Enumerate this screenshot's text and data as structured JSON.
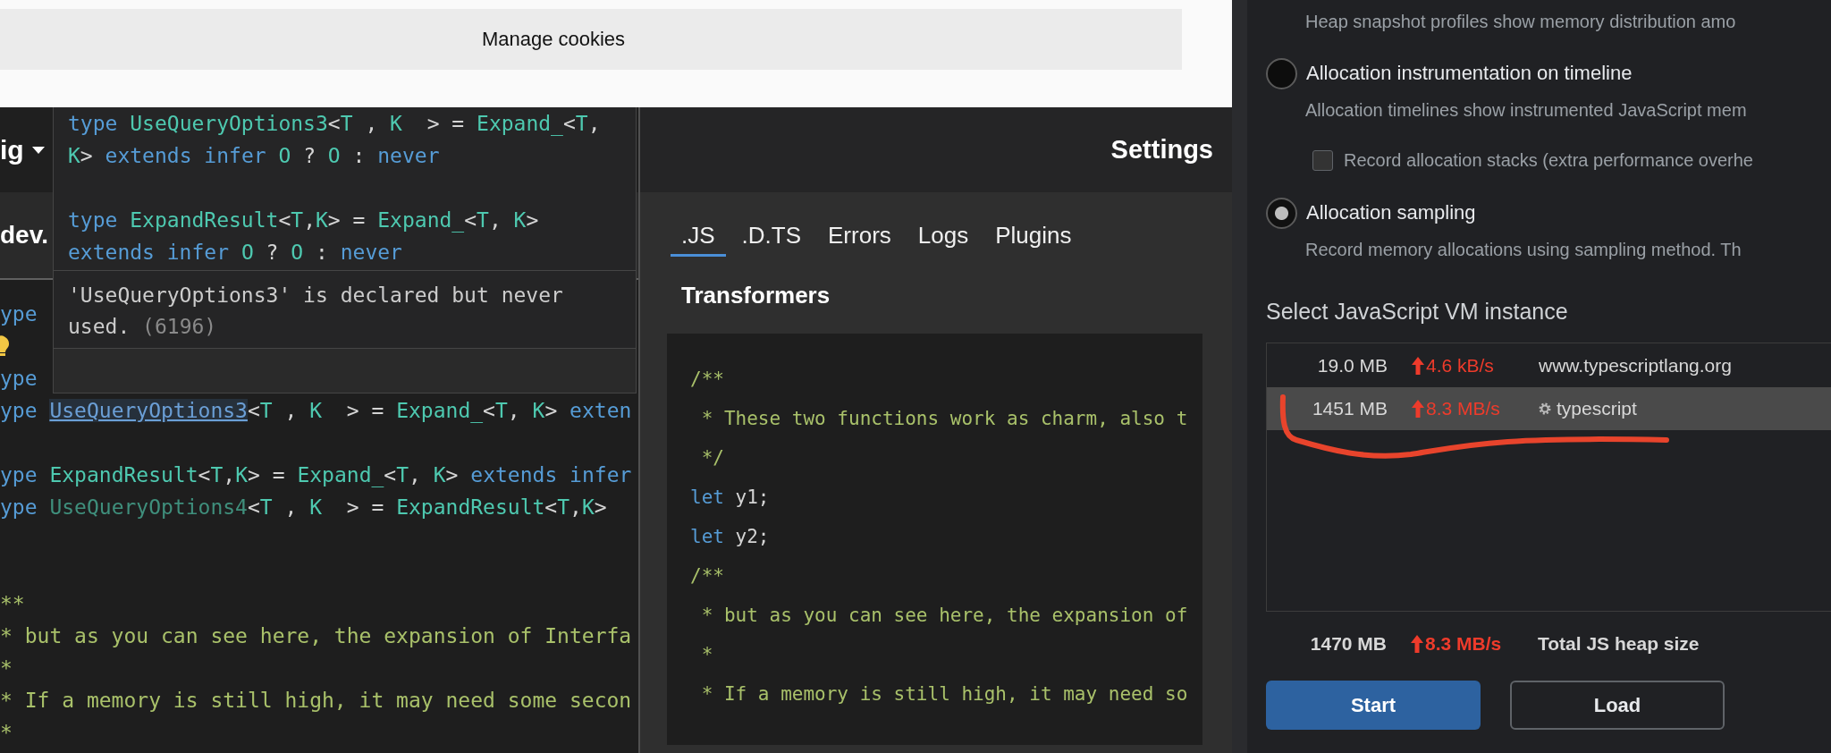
{
  "cookie_banner": {
    "button": "Manage cookies"
  },
  "editor": {
    "dropdown": "ig",
    "tab": "dev.",
    "lines": [
      {
        "kind": "code",
        "tokens": [
          {
            "kind": "keyword",
            "text": "ype"
          }
        ]
      },
      {
        "kind": "lightbulb"
      },
      {
        "kind": "code",
        "tokens": [
          {
            "kind": "keyword",
            "text": "ype"
          }
        ]
      },
      {
        "kind": "code",
        "tokens": [
          {
            "kind": "keyword",
            "text": "ype "
          },
          {
            "kind": "hover",
            "text": "UseQueryOptions3"
          },
          {
            "kind": "plain",
            "text": "<"
          },
          {
            "kind": "type",
            "text": "T"
          },
          {
            "kind": "plain",
            "text": " , "
          },
          {
            "kind": "type",
            "text": "K"
          },
          {
            "kind": "plain",
            "text": "  > = "
          },
          {
            "kind": "type",
            "text": "Expand_"
          },
          {
            "kind": "plain",
            "text": "<"
          },
          {
            "kind": "type",
            "text": "T"
          },
          {
            "kind": "plain",
            "text": ", "
          },
          {
            "kind": "type",
            "text": "K"
          },
          {
            "kind": "plain",
            "text": "> "
          },
          {
            "kind": "keyword",
            "text": "exten"
          }
        ]
      },
      {
        "kind": "blank"
      },
      {
        "kind": "code",
        "tokens": [
          {
            "kind": "keyword",
            "text": "ype "
          },
          {
            "kind": "type",
            "text": "ExpandResult"
          },
          {
            "kind": "plain",
            "text": "<"
          },
          {
            "kind": "type",
            "text": "T"
          },
          {
            "kind": "plain",
            "text": ","
          },
          {
            "kind": "type",
            "text": "K"
          },
          {
            "kind": "plain",
            "text": "> = "
          },
          {
            "kind": "type",
            "text": "Expand_"
          },
          {
            "kind": "plain",
            "text": "<"
          },
          {
            "kind": "type",
            "text": "T"
          },
          {
            "kind": "plain",
            "text": ", "
          },
          {
            "kind": "type",
            "text": "K"
          },
          {
            "kind": "plain",
            "text": "> "
          },
          {
            "kind": "keyword",
            "text": "extends infer"
          }
        ]
      },
      {
        "kind": "code",
        "tokens": [
          {
            "kind": "keyword",
            "text": "ype "
          },
          {
            "kind": "unused",
            "text": "UseQueryOptions4"
          },
          {
            "kind": "plain",
            "text": "<"
          },
          {
            "kind": "type",
            "text": "T"
          },
          {
            "kind": "plain",
            "text": " , "
          },
          {
            "kind": "type",
            "text": "K"
          },
          {
            "kind": "plain",
            "text": "  > = "
          },
          {
            "kind": "type",
            "text": "ExpandResult"
          },
          {
            "kind": "plain",
            "text": "<"
          },
          {
            "kind": "type",
            "text": "T"
          },
          {
            "kind": "plain",
            "text": ","
          },
          {
            "kind": "type",
            "text": "K"
          },
          {
            "kind": "plain",
            "text": ">"
          }
        ]
      },
      {
        "kind": "blank"
      },
      {
        "kind": "blank"
      },
      {
        "kind": "code",
        "tokens": [
          {
            "kind": "comment",
            "text": "**"
          }
        ]
      },
      {
        "kind": "code",
        "tokens": [
          {
            "kind": "comment",
            "text": "* but as you can see here, the expansion of Interfa"
          }
        ]
      },
      {
        "kind": "code",
        "tokens": [
          {
            "kind": "comment",
            "text": "*"
          }
        ]
      },
      {
        "kind": "code",
        "tokens": [
          {
            "kind": "comment",
            "text": "* If a memory is still high, it may need some secon"
          }
        ]
      },
      {
        "kind": "code",
        "tokens": [
          {
            "kind": "comment",
            "text": "*"
          }
        ]
      }
    ]
  },
  "hover_tooltip": {
    "lines": [
      {
        "kind": "code",
        "tokens": [
          {
            "kind": "keyword",
            "text": "type "
          },
          {
            "kind": "type",
            "text": "UseQueryOptions3"
          },
          {
            "kind": "plain",
            "text": "<"
          },
          {
            "kind": "type",
            "text": "T"
          },
          {
            "kind": "plain",
            "text": " , "
          },
          {
            "kind": "type",
            "text": "K"
          },
          {
            "kind": "plain",
            "text": "  > = "
          },
          {
            "kind": "type",
            "text": "Expand_"
          },
          {
            "kind": "plain",
            "text": "<"
          },
          {
            "kind": "type",
            "text": "T"
          },
          {
            "kind": "plain",
            "text": ","
          }
        ]
      },
      {
        "kind": "code",
        "tokens": [
          {
            "kind": "type",
            "text": "K"
          },
          {
            "kind": "plain",
            "text": "> "
          },
          {
            "kind": "keyword",
            "text": "extends infer "
          },
          {
            "kind": "type",
            "text": "O"
          },
          {
            "kind": "plain",
            "text": " ? "
          },
          {
            "kind": "type",
            "text": "O"
          },
          {
            "kind": "plain",
            "text": " : "
          },
          {
            "kind": "keyword",
            "text": "never"
          }
        ]
      },
      {
        "kind": "blank"
      },
      {
        "kind": "code",
        "tokens": [
          {
            "kind": "keyword",
            "text": "type "
          },
          {
            "kind": "type",
            "text": "ExpandResult"
          },
          {
            "kind": "plain",
            "text": "<"
          },
          {
            "kind": "type",
            "text": "T"
          },
          {
            "kind": "plain",
            "text": ","
          },
          {
            "kind": "type",
            "text": "K"
          },
          {
            "kind": "plain",
            "text": "> = "
          },
          {
            "kind": "type",
            "text": "Expand_"
          },
          {
            "kind": "plain",
            "text": "<"
          },
          {
            "kind": "type",
            "text": "T"
          },
          {
            "kind": "plain",
            "text": ", "
          },
          {
            "kind": "type",
            "text": "K"
          },
          {
            "kind": "plain",
            "text": ">"
          }
        ]
      },
      {
        "kind": "code",
        "tokens": [
          {
            "kind": "keyword",
            "text": "extends infer "
          },
          {
            "kind": "type",
            "text": "O"
          },
          {
            "kind": "plain",
            "text": " ? "
          },
          {
            "kind": "type",
            "text": "O"
          },
          {
            "kind": "plain",
            "text": " : "
          },
          {
            "kind": "keyword",
            "text": "never"
          }
        ]
      }
    ],
    "message": "'UseQueryOptions3' is declared but never used.",
    "error_code": "(6196)"
  },
  "settings_panel": {
    "title": "Settings",
    "tabs": [
      {
        "label": ".JS",
        "selected": true
      },
      {
        "label": ".D.TS",
        "selected": false
      },
      {
        "label": "Errors",
        "selected": false
      },
      {
        "label": "Logs",
        "selected": false
      },
      {
        "label": "Plugins",
        "selected": false
      }
    ],
    "section": "Transformers",
    "code_lines": [
      {
        "kind": "code",
        "tokens": [
          {
            "kind": "comment",
            "text": "/**"
          }
        ]
      },
      {
        "kind": "code",
        "tokens": [
          {
            "kind": "comment",
            "text": " * These two functions work as charm, also t"
          }
        ]
      },
      {
        "kind": "code",
        "tokens": [
          {
            "kind": "comment",
            "text": " */"
          }
        ]
      },
      {
        "kind": "code",
        "tokens": [
          {
            "kind": "keyword",
            "text": "let"
          },
          {
            "kind": "plain",
            "text": " y1;"
          }
        ]
      },
      {
        "kind": "code",
        "tokens": [
          {
            "kind": "keyword",
            "text": "let"
          },
          {
            "kind": "plain",
            "text": " y2;"
          }
        ]
      },
      {
        "kind": "code",
        "tokens": [
          {
            "kind": "comment",
            "text": "/**"
          }
        ]
      },
      {
        "kind": "code",
        "tokens": [
          {
            "kind": "comment",
            "text": " * but as you can see here, the expansion of"
          }
        ]
      },
      {
        "kind": "code",
        "tokens": [
          {
            "kind": "comment",
            "text": " *"
          }
        ]
      },
      {
        "kind": "code",
        "tokens": [
          {
            "kind": "comment",
            "text": " * If a memory is still high, it may need so"
          }
        ]
      }
    ]
  },
  "memory_panel": {
    "intro": "Heap snapshot profiles show memory distribution amo",
    "options": [
      {
        "kind": "radio",
        "label": "Allocation instrumentation on timeline",
        "selected": false,
        "description": "Allocation timelines show instrumented JavaScript mem"
      },
      {
        "kind": "checkbox",
        "label": "Record allocation stacks (extra performance overhe",
        "checked": false
      },
      {
        "kind": "radio",
        "label": "Allocation sampling",
        "selected": true,
        "description": "Record memory allocations using sampling method. Th"
      }
    ],
    "vm_heading": "Select JavaScript VM instance",
    "vm_instances": [
      {
        "kind": "page",
        "size": "19.0 MB",
        "rate": "4.6 kB/s",
        "name": "www.typescriptlang.org",
        "selected": false
      },
      {
        "kind": "worker",
        "size": "1451 MB",
        "rate": "8.3 MB/s",
        "name": "typescript",
        "selected": true
      }
    ],
    "total": {
      "size": "1470 MB",
      "rate": "8.3 MB/s",
      "label": "Total JS heap size"
    },
    "buttons": [
      {
        "label": "Start",
        "kind": "primary"
      },
      {
        "label": "Load",
        "kind": "secondary"
      }
    ]
  }
}
